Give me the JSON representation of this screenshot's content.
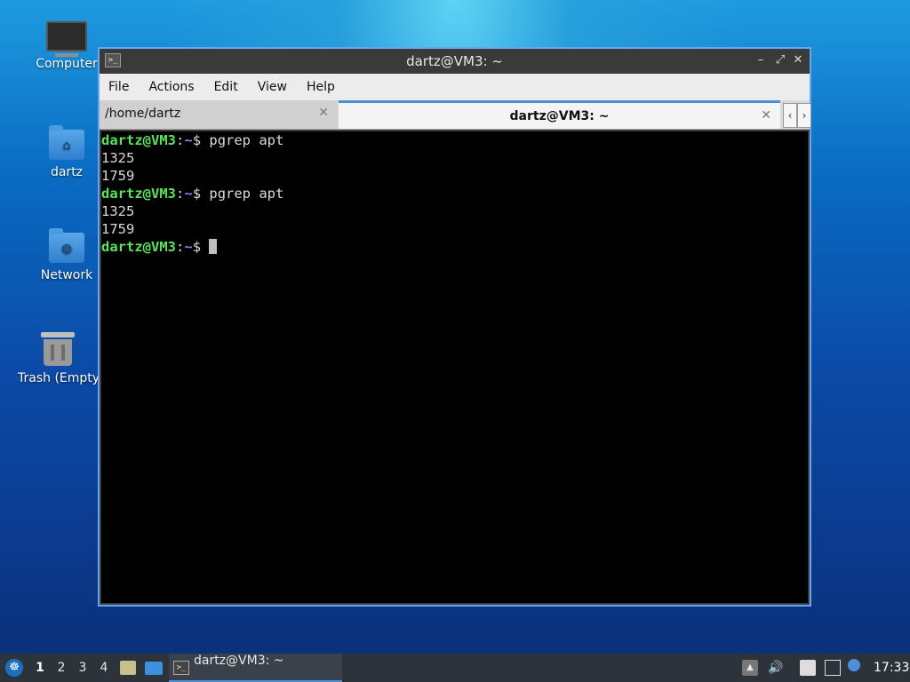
{
  "desktop": {
    "icons": [
      {
        "label": "Computer"
      },
      {
        "label": "dartz"
      },
      {
        "label": "Network"
      },
      {
        "label": "Trash (Empty)"
      }
    ]
  },
  "window": {
    "title": "dartz@VM3: ~",
    "menu": [
      "File",
      "Actions",
      "Edit",
      "View",
      "Help"
    ],
    "tabs": [
      {
        "label": "/home/dartz",
        "active": false
      },
      {
        "label": "dartz@VM3: ~",
        "active": true
      }
    ]
  },
  "terminal": {
    "prompt": {
      "user": "dartz@VM3",
      "sep": ":",
      "path": "~",
      "symbol": "$ "
    },
    "lines": [
      {
        "type": "prompt",
        "command": "pgrep apt"
      },
      {
        "type": "output",
        "text": "1325"
      },
      {
        "type": "output",
        "text": "1759"
      },
      {
        "type": "prompt",
        "command": "pgrep apt"
      },
      {
        "type": "output",
        "text": "1325"
      },
      {
        "type": "output",
        "text": "1759"
      },
      {
        "type": "prompt",
        "command": "",
        "cursor": true
      }
    ]
  },
  "taskbar": {
    "workspaces": [
      "1",
      "2",
      "3",
      "4"
    ],
    "active_workspace": "1",
    "task_label": "dartz@VM3: ~",
    "clock": "17:33"
  },
  "colors": {
    "accent": "#4a90d9",
    "prompt_user": "#5ce35c",
    "prompt_path": "#6c8cff"
  }
}
